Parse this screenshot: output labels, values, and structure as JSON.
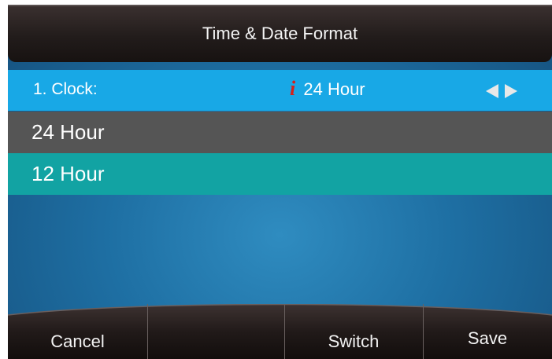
{
  "title_bar": {
    "title": "Time & Date Format"
  },
  "setting": {
    "label": "1. Clock:",
    "info_icon": "i",
    "value": "24 Hour",
    "arrows": "left-right-arrows-icon"
  },
  "options": [
    {
      "label": "24 Hour",
      "state": "highlighted-gray"
    },
    {
      "label": "12 Hour",
      "state": "selected-teal"
    }
  ],
  "softkeys": [
    {
      "label": "Cancel"
    },
    {
      "label": ""
    },
    {
      "label": "Switch"
    },
    {
      "label": "Save"
    }
  ],
  "colors": {
    "setting_row": "#18a8e6",
    "option_highlight": "#555555",
    "option_selected": "#12a3a3",
    "info_icon": "#d4211a",
    "background": "#1e6fa3"
  }
}
